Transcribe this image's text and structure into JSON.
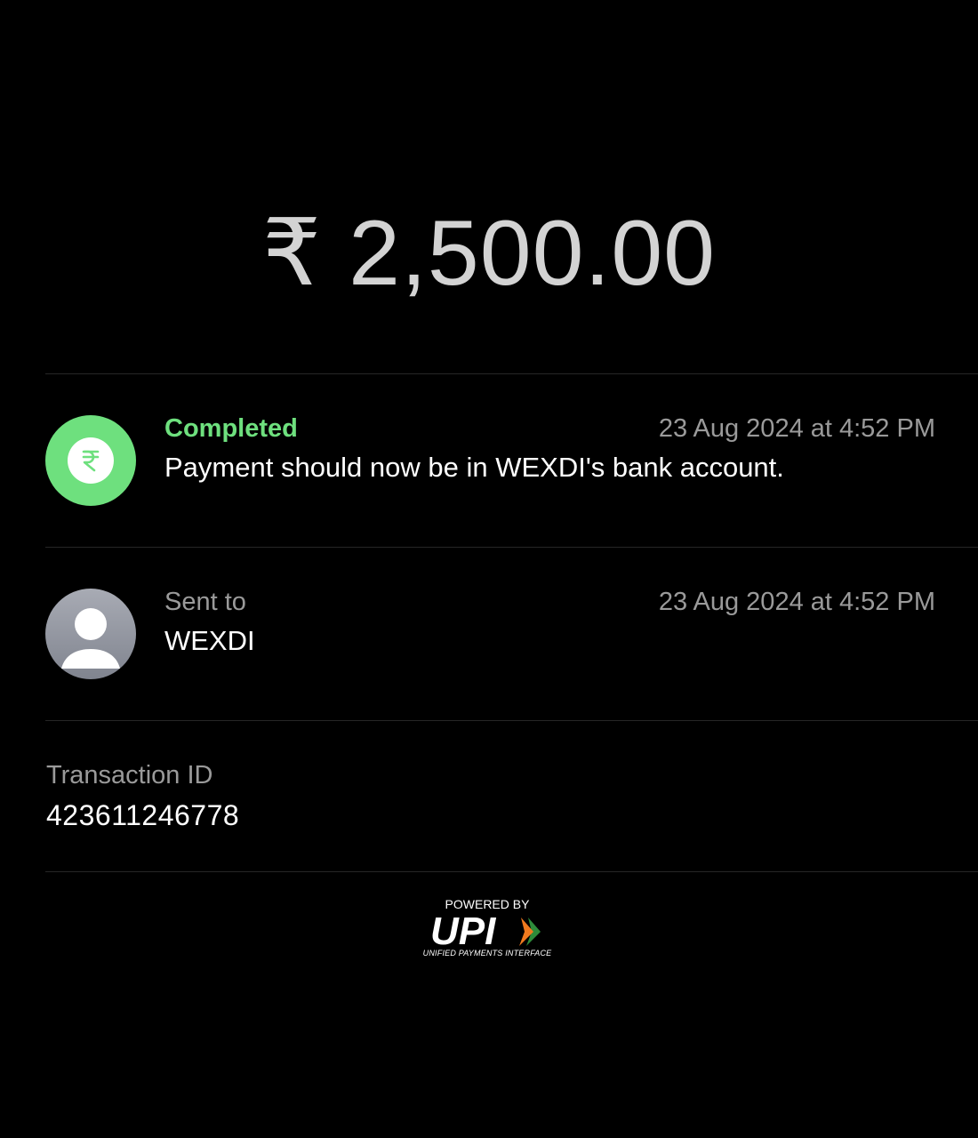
{
  "payment": {
    "currency_symbol": "₹",
    "amount": "2,500.00"
  },
  "status_row": {
    "icon": "rupee-icon",
    "status": "Completed",
    "datetime": "23 Aug 2024 at 4:52 PM",
    "message": "Payment should now be in WEXDI's bank account."
  },
  "recipient_row": {
    "icon": "person-icon",
    "label": "Sent to",
    "datetime": "23 Aug 2024 at 4:52 PM",
    "name": "WEXDI"
  },
  "transaction": {
    "label": "Transaction ID",
    "id": "423611246778"
  },
  "footer": {
    "powered_by": "POWERED BY",
    "brand": "UPI",
    "brand_full": "UNIFIED PAYMENTS INTERFACE"
  },
  "colors": {
    "background": "#000000",
    "success_green": "#6ee07e",
    "secondary_text": "#9a9a9a",
    "amount_text": "#d3d3d3"
  }
}
